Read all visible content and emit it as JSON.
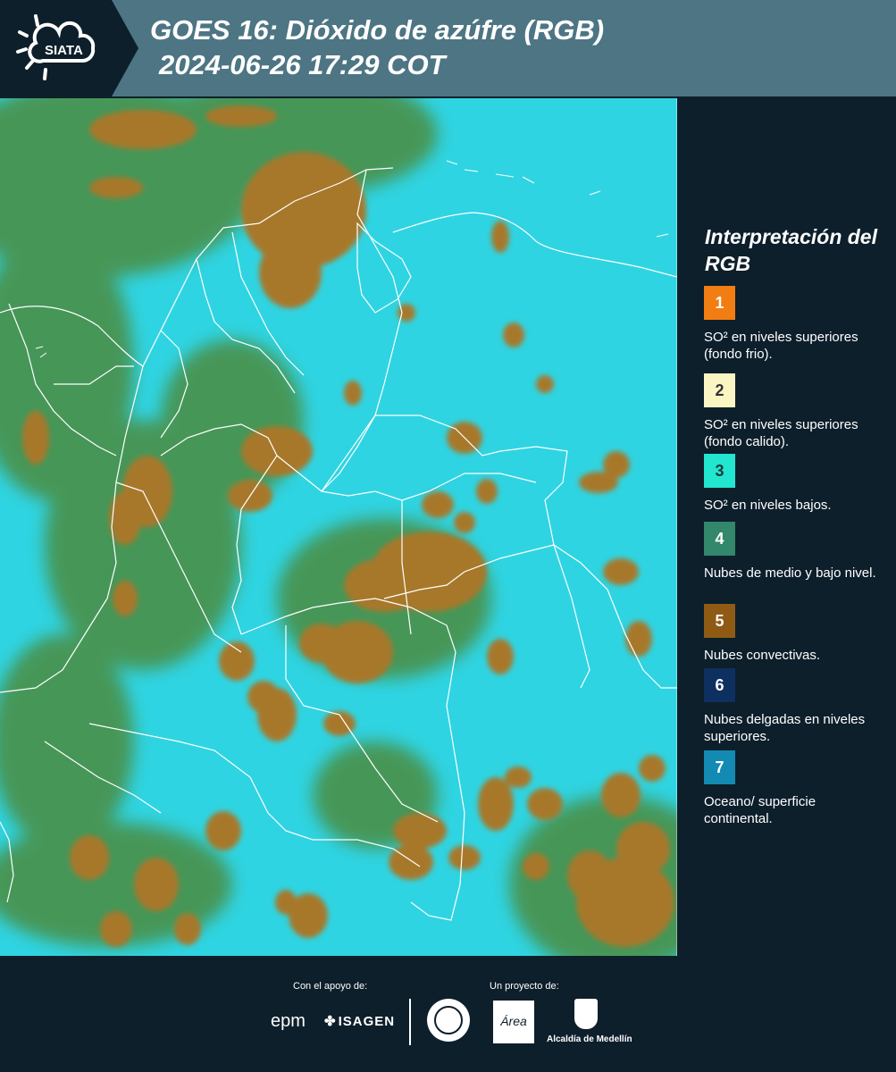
{
  "header": {
    "title_line1": "GOES 16: Dióxido de azúfre (RGB)",
    "title_line2": "2024-06-26 17:29 COT",
    "logo_text": "SIATA"
  },
  "legend": {
    "title": "Interpretación del RGB",
    "items": [
      {
        "number": "1",
        "color": "#f27d12",
        "text": "SO² en niveles superiores (fondo frio)."
      },
      {
        "number": "2",
        "color": "#fbf5c4",
        "text": "SO² en niveles superiores (fondo calido)."
      },
      {
        "number": "3",
        "color": "#22e6cf",
        "text": "SO² en niveles bajos."
      },
      {
        "number": "4",
        "color": "#33876a",
        "text": "Nubes de medio y bajo nivel."
      },
      {
        "number": "5",
        "color": "#8f5b14",
        "text": "Nubes convectivas."
      },
      {
        "number": "6",
        "color": "#0e3060",
        "text": "Nubes delgadas en niveles superiores."
      },
      {
        "number": "7",
        "color": "#138ab3",
        "text": "Oceano/ superficie continental."
      }
    ]
  },
  "footer": {
    "support_caption": "Con el apoyo de:",
    "project_caption": "Un proyecto de:",
    "sponsor_1": "epm",
    "sponsor_2": "ISAGEN",
    "partner_area": "Área",
    "partner_alcaldia": "Alcaldía de Medellín"
  },
  "map": {
    "ocean_color": "#2fd4e2",
    "cloud_color": "#a7782b",
    "low_cloud_color": "#4c8c40"
  }
}
